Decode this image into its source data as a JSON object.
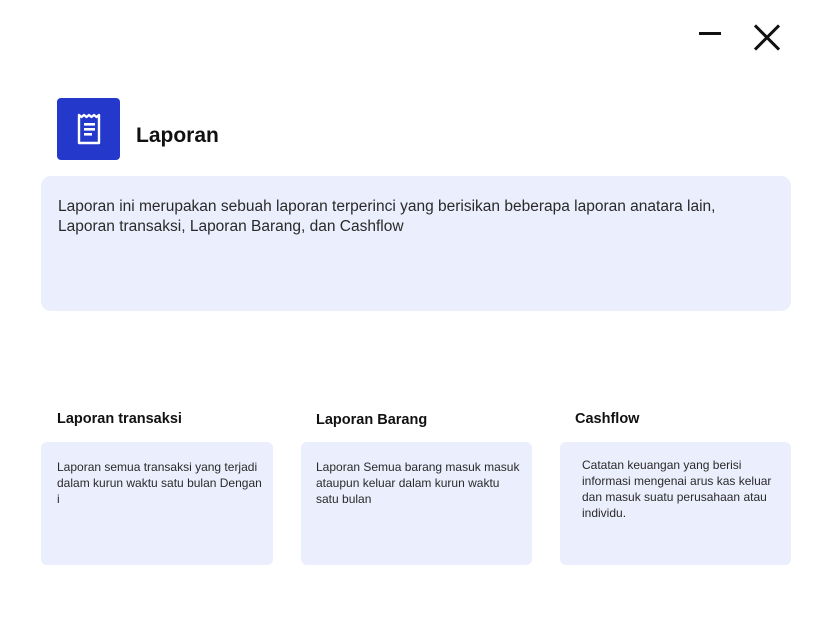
{
  "window": {
    "minimize_icon": "minimize-icon",
    "close_icon": "close-icon"
  },
  "header": {
    "icon": "receipt-icon",
    "icon_color": "#2438cc",
    "title": "Laporan"
  },
  "description": "Laporan ini merupakan sebuah laporan terperinci yang berisikan beberapa laporan anatara lain, Laporan transaksi, Laporan Barang, dan Cashflow",
  "cards": [
    {
      "title": "Laporan transaksi",
      "text": "Laporan semua transaksi yang terjadi dalam kurun waktu satu bulan Dengan i"
    },
    {
      "title": "Laporan Barang",
      "text": "Laporan Semua barang masuk masuk ataupun keluar dalam kurun waktu satu bulan"
    },
    {
      "title": "Cashflow",
      "text": "Catatan keuangan yang berisi informasi mengenai arus kas keluar dan masuk suatu perusahaan atau individu."
    }
  ],
  "colors": {
    "accent": "#2438cc",
    "panel_background": "#ebeefc"
  }
}
